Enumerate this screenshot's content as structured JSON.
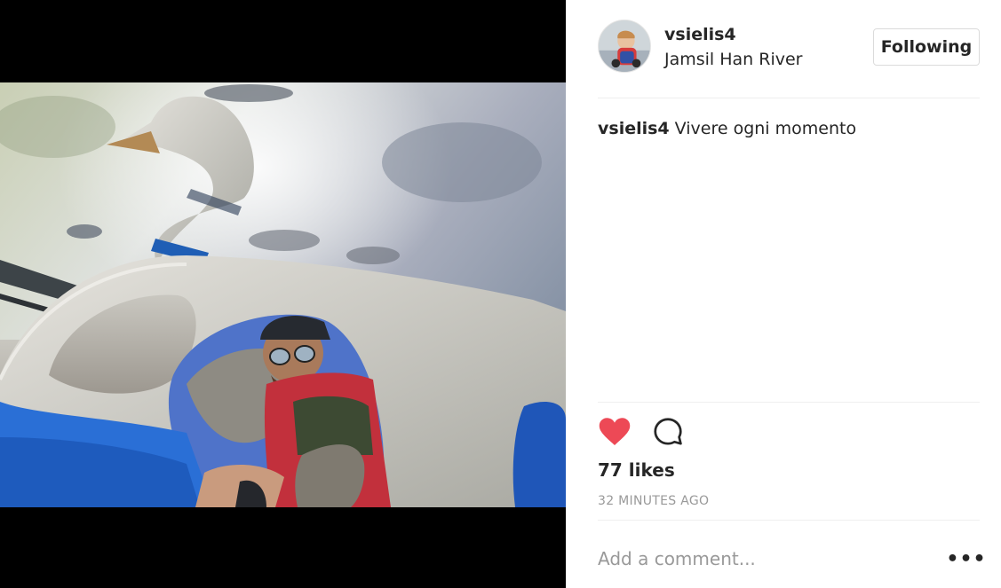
{
  "post": {
    "image_alt": "Selfie in a swan pedal boat on the river",
    "author": {
      "username": "vsielis4",
      "location": "Jamsil Han River"
    },
    "follow_button_label": "Following",
    "caption": {
      "author": "vsielis4",
      "text": "Vivere ogni momento"
    },
    "likes_text": "77 likes",
    "timestamp": "32 MINUTES AGO",
    "comment_placeholder": "Add a comment...",
    "more_icon_glyph": "•••",
    "liked": true
  },
  "icons": {
    "like": "heart-icon",
    "comment": "comment-bubble-icon",
    "more": "ellipsis-icon"
  },
  "colors": {
    "heart": "#ed4956",
    "text": "#262626",
    "muted": "#999999",
    "border": "#dbdbdb"
  }
}
